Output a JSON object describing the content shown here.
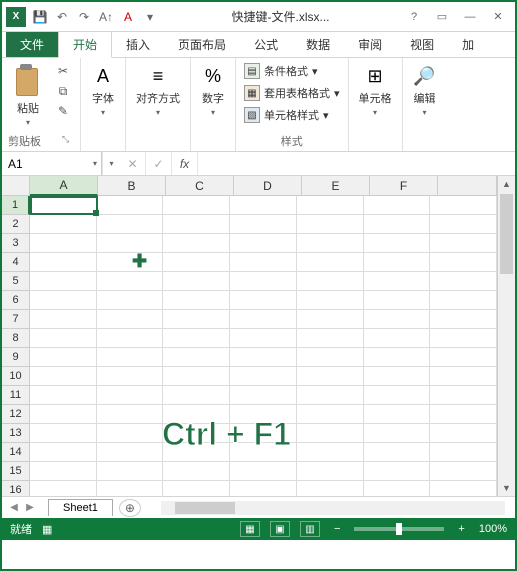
{
  "titlebar": {
    "app_icon_text": "X",
    "title": "快捷键-文件.xlsx...",
    "help_icon": "?",
    "ribbon_toggle_icon": "▭",
    "minimize_icon": "—",
    "close_icon": "✕"
  },
  "qat": {
    "save_icon": "💾",
    "undo_icon": "↶",
    "redo_icon": "↷",
    "font_icon": "A↑",
    "font_color_icon": "A",
    "more_icon": "▾"
  },
  "tabs": {
    "file": "文件",
    "home": "开始",
    "insert": "插入",
    "page_layout": "页面布局",
    "formulas": "公式",
    "data": "数据",
    "review": "审阅",
    "view": "视图",
    "addins": "加"
  },
  "ribbon": {
    "clipboard": {
      "paste": "粘贴",
      "label": "剪贴板",
      "cut_icon": "✂",
      "copy_icon": "⧉",
      "brush_icon": "✎"
    },
    "font": {
      "label": "字体",
      "icon": "A"
    },
    "align": {
      "label": "对齐方式",
      "icon": "≡"
    },
    "number": {
      "label": "数字",
      "icon": "%"
    },
    "styles": {
      "cond_format": "条件格式",
      "table_format": "套用表格格式",
      "cell_styles": "单元格样式",
      "label": "样式"
    },
    "cells": {
      "label": "单元格",
      "icon": "⊞"
    },
    "editing": {
      "label": "编辑",
      "icon": "🔎"
    },
    "dropdown_arrow": "▾",
    "expand_icon": "⤡"
  },
  "formula_bar": {
    "name_box": "A1",
    "cancel_icon": "✕",
    "confirm_icon": "✓",
    "fx_label": "fx",
    "input_value": ""
  },
  "grid": {
    "columns": [
      "A",
      "B",
      "C",
      "D",
      "E",
      "F"
    ],
    "rows": [
      "1",
      "2",
      "3",
      "4",
      "5",
      "6",
      "7",
      "8",
      "9",
      "10",
      "11",
      "12",
      "13",
      "14",
      "15",
      "16"
    ],
    "active_cell": "A1",
    "overlay_text": "Ctrl + F1"
  },
  "sheet_bar": {
    "prev_icon": "◀",
    "next_icon": "▶",
    "sheet1": "Sheet1",
    "add_icon": "⊕"
  },
  "status_bar": {
    "ready": "就绪",
    "macro_icon": "▦",
    "view_normal": "▦",
    "view_page": "▣",
    "view_break": "▥",
    "zoom_out": "−",
    "zoom_in": "+",
    "zoom_value": "100%"
  }
}
